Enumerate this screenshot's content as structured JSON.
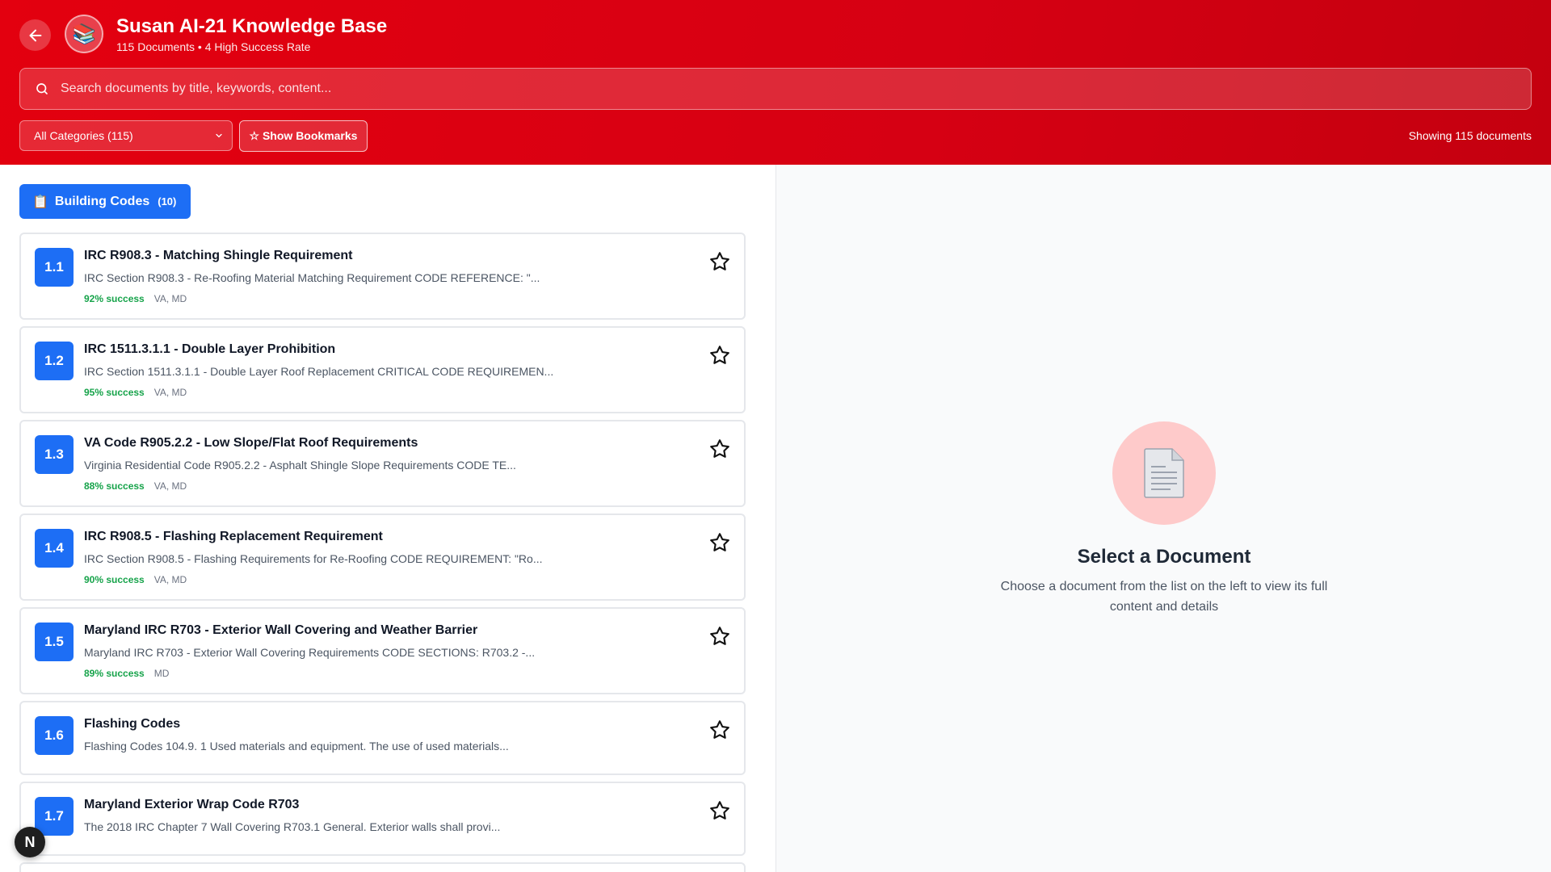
{
  "header": {
    "title": "Susan AI-21 Knowledge Base",
    "subtitle": "115 Documents • 4 High Success Rate",
    "logo_icon": "📚"
  },
  "search": {
    "placeholder": "Search documents by title, keywords, content...",
    "value": ""
  },
  "filters": {
    "category_selected": "All Categories (115)",
    "bookmarks_label": "☆ Show Bookmarks",
    "showing_text": "Showing 115 documents"
  },
  "category": {
    "icon": "📋",
    "name": "Building Codes",
    "count": "(10)"
  },
  "documents": [
    {
      "num": "1.1",
      "title": "IRC R908.3 - Matching Shingle Requirement",
      "desc": "IRC Section R908.3 - Re-Roofing Material Matching Requirement CODE REFERENCE: \"...",
      "success": "92% success",
      "states": "VA, MD"
    },
    {
      "num": "1.2",
      "title": "IRC 1511.3.1.1 - Double Layer Prohibition",
      "desc": "IRC Section 1511.3.1.1 - Double Layer Roof Replacement CRITICAL CODE REQUIREMEN...",
      "success": "95% success",
      "states": "VA, MD"
    },
    {
      "num": "1.3",
      "title": "VA Code R905.2.2 - Low Slope/Flat Roof Requirements",
      "desc": "Virginia Residential Code R905.2.2 - Asphalt Shingle Slope Requirements CODE TE...",
      "success": "88% success",
      "states": "VA, MD"
    },
    {
      "num": "1.4",
      "title": "IRC R908.5 - Flashing Replacement Requirement",
      "desc": "IRC Section R908.5 - Flashing Requirements for Re-Roofing CODE REQUIREMENT: \"Ro...",
      "success": "90% success",
      "states": "VA, MD"
    },
    {
      "num": "1.5",
      "title": "Maryland IRC R703 - Exterior Wall Covering and Weather Barrier",
      "desc": "Maryland IRC R703 - Exterior Wall Covering Requirements CODE SECTIONS: R703.2 -...",
      "success": "89% success",
      "states": "MD"
    },
    {
      "num": "1.6",
      "title": "Flashing Codes",
      "desc": "Flashing Codes 104.9. 1 Used materials and equipment. The use of used materials...",
      "success": "",
      "states": ""
    },
    {
      "num": "1.7",
      "title": "Maryland Exterior Wrap Code R703",
      "desc": "The 2018 IRC Chapter 7 Wall Covering R703.1 General. Exterior walls shall provi...",
      "success": "",
      "states": ""
    }
  ],
  "empty_state": {
    "icon": "📄",
    "title": "Select a Document",
    "description": "Choose a document from the list on the left to view its full content and details"
  },
  "fab_label": "N",
  "colors": {
    "brand_red": "#e3000f",
    "accent_blue": "#1d6ef5",
    "success_green": "#16a34a"
  }
}
